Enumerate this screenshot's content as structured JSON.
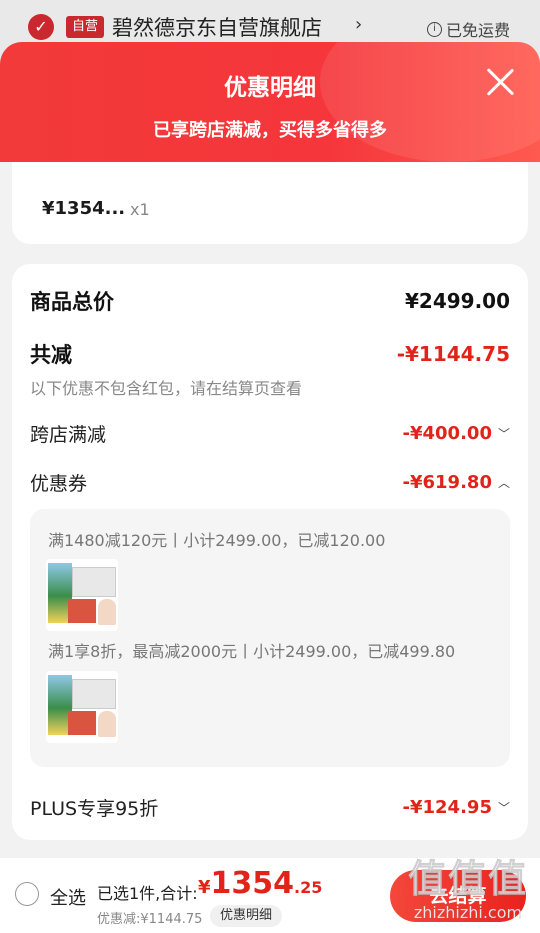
{
  "store": {
    "tag": "自营",
    "name": "碧然德京东自营旗舰店",
    "shipping": "已免运费"
  },
  "modal": {
    "title": "优惠明细",
    "subtitle": "已享跨店满减，买得多省得多"
  },
  "item": {
    "price": "¥1354...",
    "qty": "x1"
  },
  "summary": {
    "goods_total_label": "商品总价",
    "goods_total_value": "¥2499.00",
    "total_discount_label": "共减",
    "total_discount_value": "-¥1144.75",
    "note": "以下优惠不包含红包，请在结算页查看",
    "cross_store_label": "跨店满减",
    "cross_store_value": "-¥400.00",
    "coupon_label": "优惠券",
    "coupon_value": "-¥619.80",
    "coupon_rules": [
      "满1480减120元丨小计2499.00，已减120.00",
      "满1享8折，最高减2000元丨小计2499.00，已减499.80"
    ],
    "plus_label": "PLUS专享95折",
    "plus_value": "-¥124.95"
  },
  "bottom": {
    "select_all": "全选",
    "selected": "已选1件,合计:",
    "currency": "¥",
    "total_int": "1354",
    "total_dec": ".25",
    "discount_text": "优惠减:¥1144.75",
    "detail_button": "优惠明细",
    "checkout_button": "去结算"
  },
  "watermark": {
    "mark": "值值值",
    "site": "zhizhizhi.com"
  },
  "colors": {
    "accent": "#e2231a",
    "header_gradient_start": "#f23a3a"
  }
}
